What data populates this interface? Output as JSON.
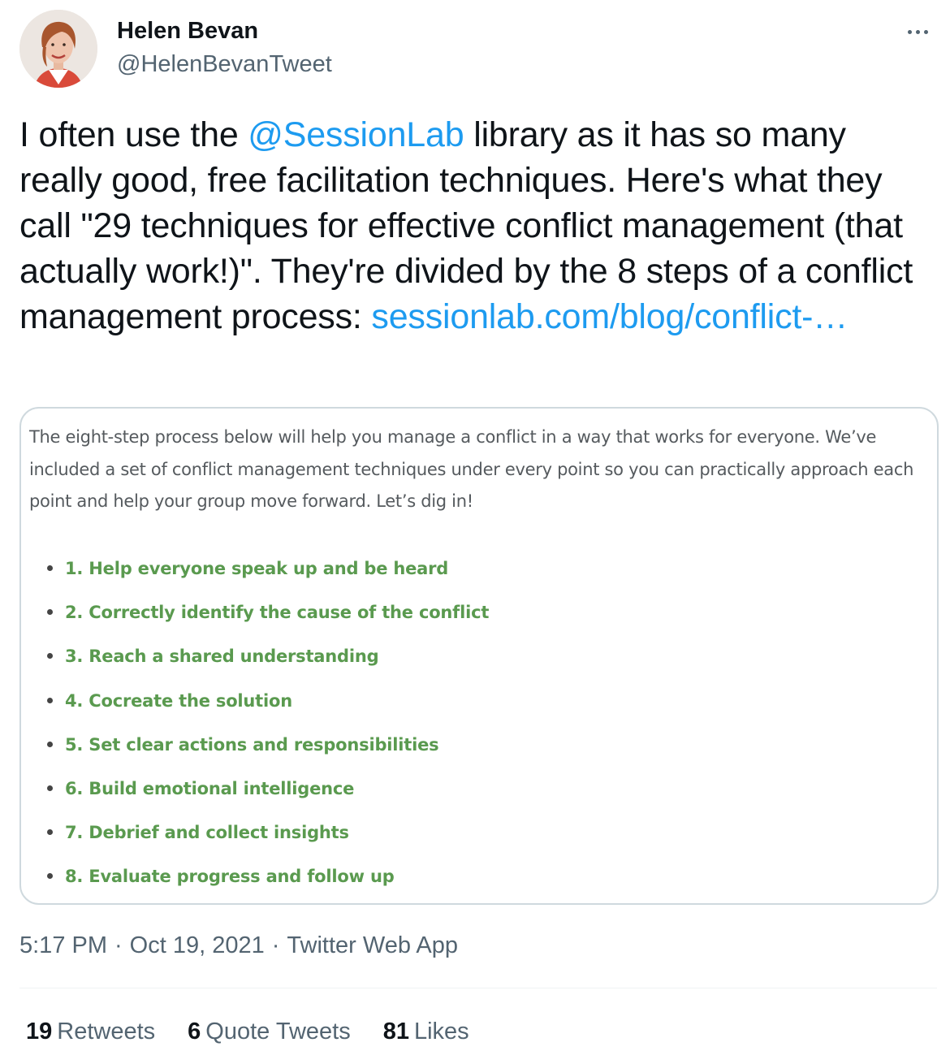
{
  "author": {
    "display_name": "Helen Bevan",
    "handle": "@HelenBevanTweet",
    "avatar_icon": "profile-photo"
  },
  "more_icon": "more-horizontal-icon",
  "tweet": {
    "text_before_mention": "I often use the ",
    "mention": "@SessionLab",
    "text_after_mention": " library as it has so many really good, free facilitation techniques. Here's what they call \"29 techniques for effective conflict management (that actually work!)\". They're divided by the 8 steps of a conflict management process: ",
    "link": "sessionlab.com/blog/conflict-…"
  },
  "media": {
    "intro": "The eight-step process below will help you manage a conflict in a way that works for everyone. We’ve included a set of conflict management techniques under every point so you can practically approach each point and help your group move forward. Let’s dig in!",
    "steps": [
      "1. Help everyone speak up and be heard",
      "2. Correctly identify the cause of the conflict",
      "3. Reach a shared understanding",
      "4. Cocreate the solution",
      "5. Set clear actions and responsibilities",
      "6. Build emotional intelligence",
      "7. Debrief and collect insights",
      "8. Evaluate progress and follow up"
    ],
    "step_color": "#5a9a4f"
  },
  "meta": {
    "time": "5:17 PM",
    "date": "Oct 19, 2021",
    "source": "Twitter Web App",
    "separator": "·"
  },
  "stats": {
    "retweets_count": "19",
    "retweets_label": "Retweets",
    "quotes_count": "6",
    "quotes_label": "Quote Tweets",
    "likes_count": "81",
    "likes_label": "Likes"
  },
  "colors": {
    "link": "#1d9bf0",
    "text": "#0f1419",
    "secondary": "#536471",
    "border": "#cfd9de"
  }
}
